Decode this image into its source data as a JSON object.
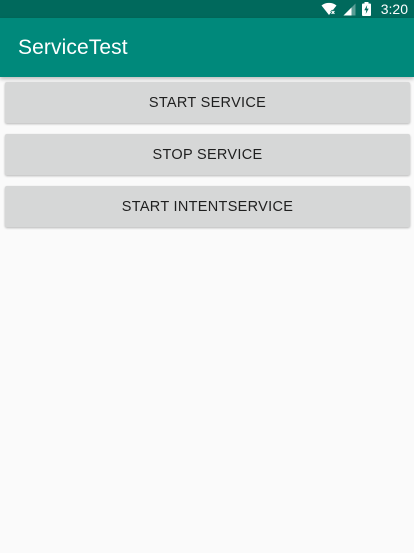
{
  "status_bar": {
    "icons": [
      "wifi-off-icon",
      "signal-icon",
      "battery-charging-icon"
    ],
    "time": "3:20",
    "color": "#00695c"
  },
  "app_bar": {
    "title": "ServiceTest",
    "color": "#00897b"
  },
  "buttons": [
    {
      "label": "START SERVICE"
    },
    {
      "label": "STOP SERVICE"
    },
    {
      "label": "START INTENTSERVICE"
    }
  ]
}
